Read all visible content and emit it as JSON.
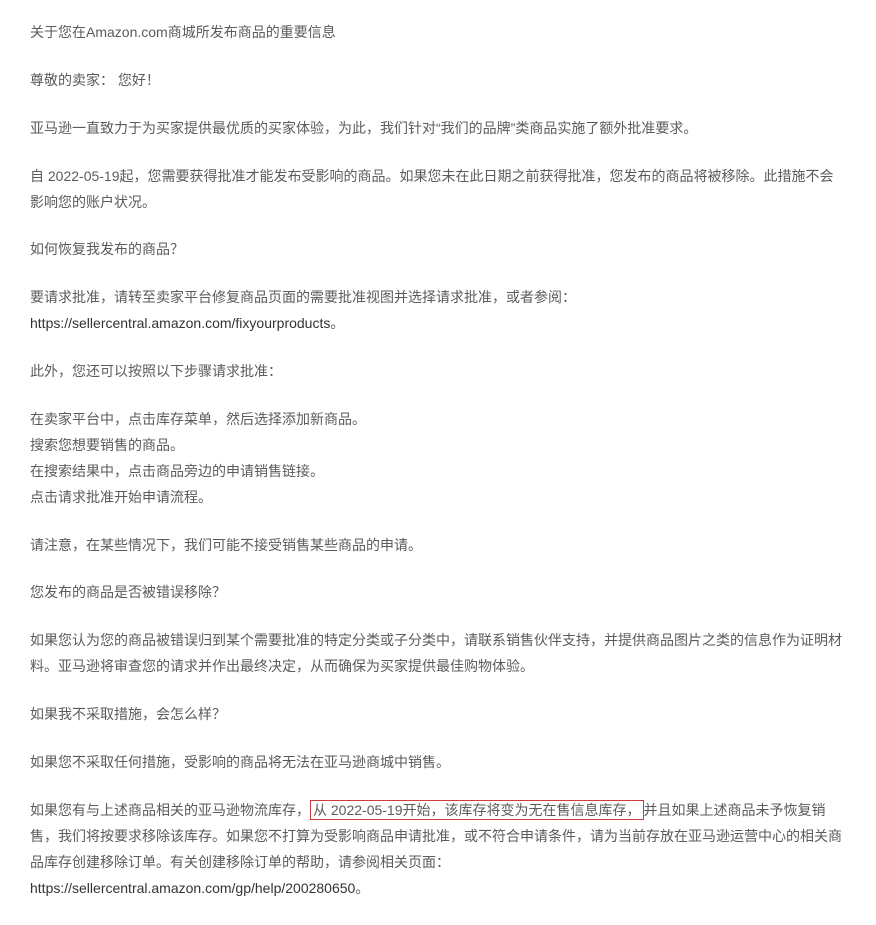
{
  "doc": {
    "title": "关于您在Amazon.com商城所发布商品的重要信息",
    "greeting": "尊敬的卖家： 您好！",
    "p1": "亚马逊一直致力于为买家提供最优质的买家体验，为此，我们针对“我们的品牌”类商品实施了额外批准要求。",
    "p2": "自 2022-05-19起，您需要获得批准才能发布受影响的商品。如果您未在此日期之前获得批准，您发布的商品将被移除。此措施不会影响您的账户状况。",
    "q1": "如何恢复我发布的商品？",
    "p3_pre": "要请求批准，请转至卖家平台修复商品页面的需要批准视图并选择请求批准，或者参阅：",
    "link1": "https://sellercentral.amazon.com/fixyourproducts",
    "p3_post": "。",
    "p4": "此外，您还可以按照以下步骤请求批准：",
    "steps": {
      "s1": "在卖家平台中，点击库存菜单，然后选择添加新商品。",
      "s2": "搜索您想要销售的商品。",
      "s3": "在搜索结果中，点击商品旁边的申请销售链接。",
      "s4": "点击请求批准开始申请流程。"
    },
    "p5": "请注意，在某些情况下，我们可能不接受销售某些商品的申请。",
    "q2": "您发布的商品是否被错误移除？",
    "p6": "如果您认为您的商品被错误归到某个需要批准的特定分类或子分类中，请联系销售伙伴支持，并提供商品图片之类的信息作为证明材料。亚马逊将审查您的请求并作出最终决定，从而确保为买家提供最佳购物体验。",
    "q3": "如果我不采取措施，会怎么样？",
    "p7": "如果您不采取任何措施，受影响的商品将无法在亚马逊商城中销售。",
    "p8": {
      "pre": "如果您有与上述商品相关的亚马逊物流库存，",
      "hl": "从 2022-05-19开始，该库存将变为无在售信息库存，",
      "post": "并且如果上述商品未予恢复销售，我们将按要求移除该库存。如果您不打算为受影响商品申请批准，或不符合申请条件，请为当前存放在亚马逊运营中心的相关商品库存创建移除订单。有关创建移除订单的帮助，请参阅相关页面："
    },
    "link2": "https://sellercentral.amazon.com/gp/help/200280650",
    "p8_post": "。"
  }
}
